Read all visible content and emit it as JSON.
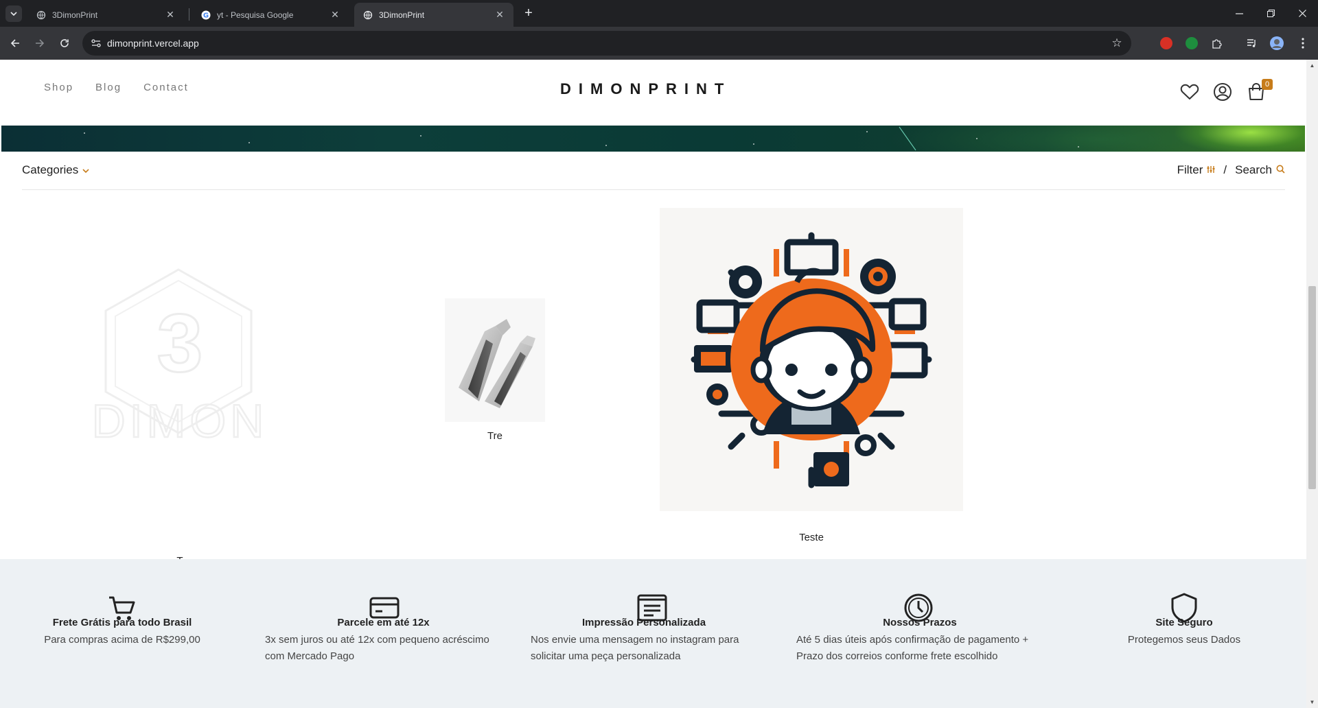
{
  "browser": {
    "tabs": [
      {
        "title": "3DimonPrint",
        "active": false
      },
      {
        "title": "yt - Pesquisa Google",
        "active": false
      },
      {
        "title": "3DimonPrint",
        "active": true
      }
    ],
    "url": "dimonprint.vercel.app"
  },
  "header": {
    "nav": [
      "Shop",
      "Blog",
      "Contact"
    ],
    "brand": "DIMONPRINT",
    "cart_count": "0"
  },
  "filterbar": {
    "categories_label": "Categories",
    "filter_label": "Filter",
    "separator": "/",
    "search_label": "Search"
  },
  "products": [
    {
      "name": "T",
      "logo_text": "DIMON",
      "logo_digit": "3"
    },
    {
      "name": "Tre"
    },
    {
      "name": "Teste"
    }
  ],
  "features": [
    {
      "title": "Frete Grátis para todo Brasil",
      "desc": "Para compras acima de R$299,00",
      "icon": "cart-icon"
    },
    {
      "title": "Parcele em até 12x",
      "desc": "3x sem juros ou até 12x com pequeno acréscimo com Mercado Pago",
      "icon": "credit-card-icon"
    },
    {
      "title": "Impressão Personalizada",
      "desc": "Nos envie uma mensagem no instagram para solicitar uma peça personalizada",
      "icon": "document-icon"
    },
    {
      "title": "Nossos Prazos",
      "desc": "Até 5 dias úteis após confirmação de pagamento + Prazo dos correios conforme frete escolhido",
      "icon": "clock-icon"
    },
    {
      "title": "Site Seguro",
      "desc": "Protegemos seus Dados",
      "icon": "shield-icon"
    }
  ],
  "colors": {
    "accent": "#c77c1a",
    "footer_bg": "#edf1f4",
    "chrome_bg": "#202124"
  }
}
